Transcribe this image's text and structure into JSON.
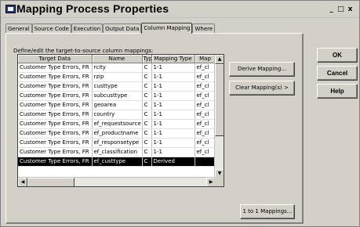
{
  "window": {
    "title": "Mapping Process Properties",
    "controls": [
      "_",
      "□",
      "x"
    ]
  },
  "tabs": [
    "General",
    "Source Code",
    "Execution",
    "Output Data",
    "Column Mapping",
    "Where"
  ],
  "active_tab": "Column Mapping",
  "panel": {
    "label": "Define/edit the target-to-source column mappings:"
  },
  "grid": {
    "columns": [
      "Target Data",
      "Name",
      "Type",
      "Mapping Type",
      "Map"
    ],
    "rows": [
      {
        "target": "Customer Type Errors, FR",
        "name": "rcity",
        "type": "C",
        "mtype": "1-1",
        "map": "ef_cl"
      },
      {
        "target": "Customer Type Errors, FR",
        "name": "rzip",
        "type": "C",
        "mtype": "1-1",
        "map": "ef_cl"
      },
      {
        "target": "Customer Type Errors, FR",
        "name": "custtype",
        "type": "C",
        "mtype": "1-1",
        "map": "ef_cl"
      },
      {
        "target": "Customer Type Errors, FR",
        "name": "subcusttype",
        "type": "C",
        "mtype": "1-1",
        "map": "ef_cl"
      },
      {
        "target": "Customer Type Errors, FR",
        "name": "geoarea",
        "type": "C",
        "mtype": "1-1",
        "map": "ef_cl"
      },
      {
        "target": "Customer Type Errors, FR",
        "name": "country",
        "type": "C",
        "mtype": "1-1",
        "map": "ef_cl"
      },
      {
        "target": "Customer Type Errors, FR",
        "name": "ef_requestsource",
        "type": "C",
        "mtype": "1-1",
        "map": "ef_cl"
      },
      {
        "target": "Customer Type Errors, FR",
        "name": "ef_productname",
        "type": "C",
        "mtype": "1-1",
        "map": "ef_cl"
      },
      {
        "target": "Customer Type Errors, FR",
        "name": "ef_responsetype",
        "type": "C",
        "mtype": "1-1",
        "map": "ef_cl"
      },
      {
        "target": "Customer Type Errors, FR",
        "name": "ef_classification",
        "type": "C",
        "mtype": "1-1",
        "map": "ef_cl"
      },
      {
        "target": "Customer Type Errors, FR",
        "name": "ef_custtype",
        "type": "C",
        "mtype": "Derived",
        "map": ""
      }
    ],
    "selected_row": 10
  },
  "buttons": {
    "derive": "Derive Mapping...",
    "clear": "Clear Mapping(s) >",
    "one_to_one": "1 to 1 Mappings...",
    "ok": "OK",
    "cancel": "Cancel",
    "help": "Help"
  }
}
